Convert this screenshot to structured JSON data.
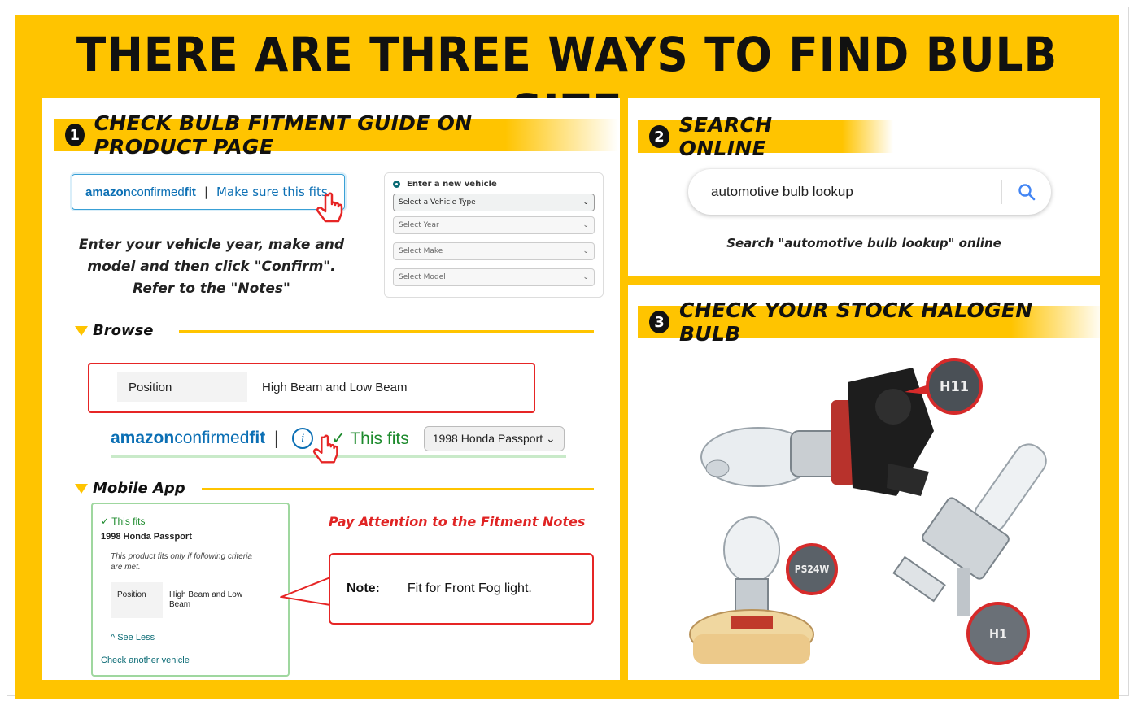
{
  "headline": "THERE ARE THREE WAYS TO FIND BULB SIZE",
  "sections": [
    {
      "num": "1",
      "title": "CHECK BULB FITMENT GUIDE ON PRODUCT PAGE"
    },
    {
      "num": "2",
      "title": "SEARCH ONLINE"
    },
    {
      "num": "3",
      "title": "CHECK YOUR STOCK HALOGEN BULB"
    }
  ],
  "brand": {
    "amazon": "amazon",
    "confirmed": "confirmed",
    "fit": "fit"
  },
  "confirm": {
    "separator": "|",
    "link": "Make sure this fits"
  },
  "instructions": {
    "line1": "Enter your vehicle year, make and",
    "line2": "model and then click \"Confirm\".",
    "line3": "Refer to the \"Notes\""
  },
  "vehicle_form": {
    "radio_label": "Enter a new vehicle",
    "selects": [
      "Select a Vehicle Type",
      "Select Year",
      "Select Make",
      "Select Model"
    ]
  },
  "browse": {
    "heading": "Browse",
    "position_label": "Position",
    "position_value": "High Beam and Low Beam",
    "this_fits": "✓ This fits",
    "vehicle": "1998 Honda Passport"
  },
  "mobile": {
    "heading": "Mobile App",
    "this_fits": "✓ This fits",
    "vehicle": "1998 Honda Passport",
    "criteria": "This product fits only if following criteria are met.",
    "position_label": "Position",
    "position_value": "High Beam and Low Beam",
    "see_less": "^ See Less",
    "check_another": "Check another vehicle"
  },
  "attention": "Pay Attention to the Fitment Notes",
  "note": {
    "label": "Note:",
    "text": "Fit for Front Fog light."
  },
  "search": {
    "query": "automotive bulb lookup",
    "caption": "Search \"automotive bulb lookup\"  online"
  },
  "bulbs": {
    "h11": "H11",
    "ps24w": "PS24W",
    "h1": "H1"
  },
  "colors": {
    "yellow": "#ffc400",
    "amazon_blue": "#0b6fb4",
    "fit_green": "#1c8a2c",
    "alert_red": "#e62525"
  }
}
